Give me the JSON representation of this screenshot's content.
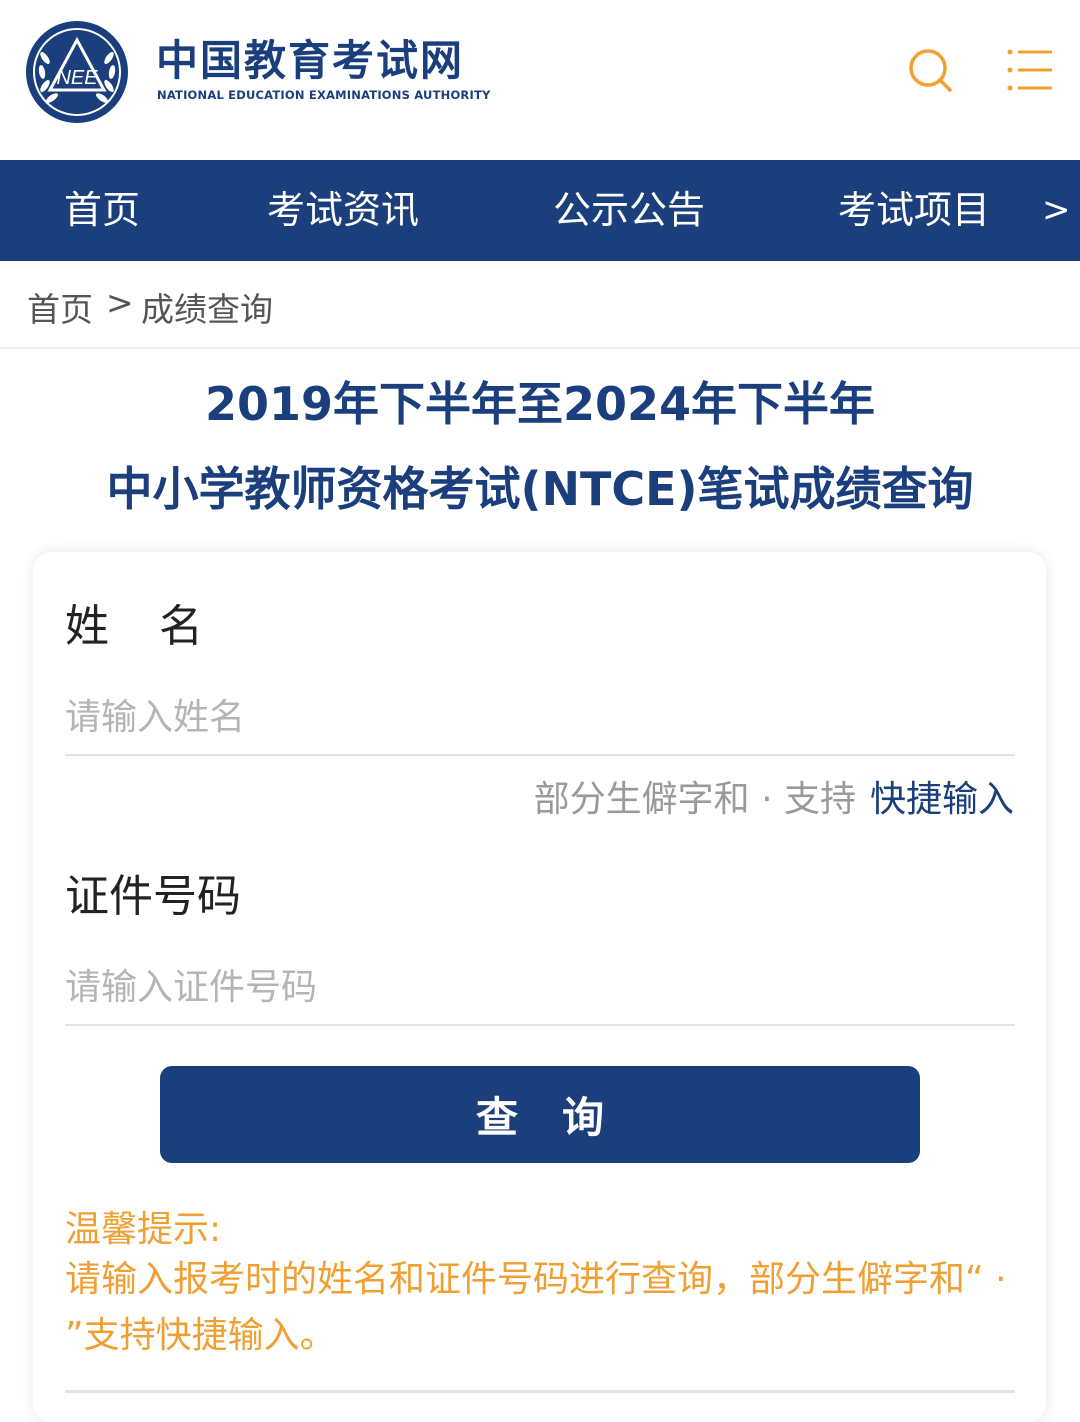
{
  "header": {
    "logo_emblem_text": "NEE",
    "logo_title": "中国教育考试网",
    "logo_subtitle": "NATIONAL EDUCATION EXAMINATIONS AUTHORITY",
    "search_icon": "search-icon",
    "menu_icon": "menu-icon"
  },
  "nav": {
    "items": [
      "首页",
      "考试资讯",
      "公示公告",
      "考试项目"
    ],
    "more": ">"
  },
  "breadcrumb": {
    "home": "首页",
    "separator": ">",
    "current": "成绩查询"
  },
  "page": {
    "title_line1": "2019年下半年至2024年下半年",
    "title_line2": "中小学教师资格考试(NTCE)笔试成绩查询"
  },
  "form": {
    "name_label": "姓名",
    "name_placeholder": "请输入姓名",
    "name_value": "",
    "hint_text": "部分生僻字和 · 支持",
    "hint_link": "快捷输入",
    "id_label": "证件号码",
    "id_placeholder": "请输入证件号码",
    "id_value": "",
    "submit_label": "查询"
  },
  "tips": {
    "title": "温馨提示:",
    "body": "请输入报考时的姓名和证件号码进行查询，部分生僻字和“ · ”支持快捷输入。"
  },
  "colors": {
    "brand": "#1b3e7c",
    "tip": "#f0a033",
    "icon_orange": "#f0a033"
  }
}
